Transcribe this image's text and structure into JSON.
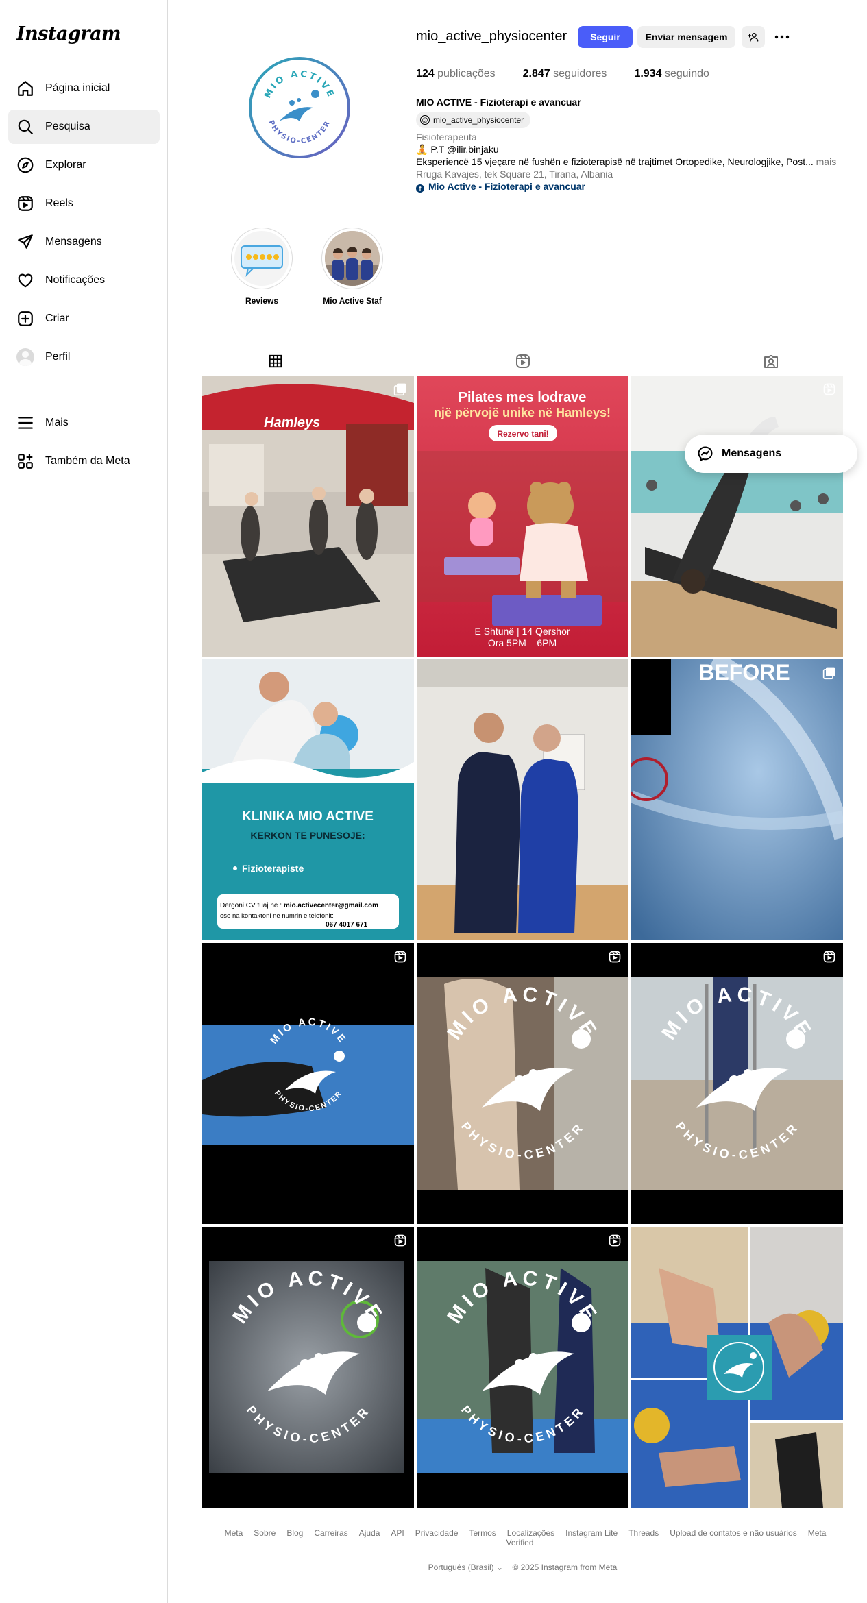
{
  "brand": {
    "logo_text": "Instagram"
  },
  "nav": {
    "items": [
      {
        "label": "Página inicial",
        "icon": "home-icon"
      },
      {
        "label": "Pesquisa",
        "icon": "search-icon"
      },
      {
        "label": "Explorar",
        "icon": "compass-icon"
      },
      {
        "label": "Reels",
        "icon": "reels-icon"
      },
      {
        "label": "Mensagens",
        "icon": "send-icon"
      },
      {
        "label": "Notificações",
        "icon": "heart-icon"
      },
      {
        "label": "Criar",
        "icon": "plus-square-icon"
      },
      {
        "label": "Perfil",
        "icon": "avatar"
      }
    ],
    "bottom": [
      {
        "label": "Mais",
        "icon": "menu-icon"
      },
      {
        "label": "Também da Meta",
        "icon": "meta-apps-icon"
      }
    ]
  },
  "profile": {
    "username": "mio_active_physiocenter",
    "follow_label": "Seguir",
    "message_label": "Enviar mensagem",
    "posts_count": "124",
    "posts_label": "publicações",
    "followers_count": "2.847",
    "followers_label": "seguidores",
    "following_count": "1.934",
    "following_label": "seguindo",
    "full_name": "MIO ACTIVE - Fizioterapi e avancuar",
    "threads_handle": "mio_active_physiocenter",
    "category": "Fisioterapeuta",
    "bio_line1": "🧘 P.T @ilir.binjaku",
    "bio_line2": "Eksperiencë 15 vjeçare në fushën e fizioterapisë në trajtimet Ortopedike, Neurologjike, Post...",
    "bio_more": "mais",
    "address": "Rruga Kavajes, tek Square 21, Tirana, Albania",
    "link_label": "Mio Active - Fizioterapi e avancuar",
    "logo_text_top": "MIO ACTIVE",
    "logo_text_bottom": "PHYSIO-CENTER"
  },
  "highlights": [
    {
      "label": "Reviews"
    },
    {
      "label": "Mio Active Staf"
    }
  ],
  "posts": {
    "p2_title": "Pilates mes lodrave",
    "p2_subtitle": "një përvojë unike në Hamleys!",
    "p2_cta": "Rezervo tani!",
    "p2_date": "E Shtunë | 14 Qershor",
    "p2_time": "Ora 5PM – 6PM",
    "p1_store": "Hamleys",
    "p4_title": "KLINIKA MIO ACTIVE",
    "p4_subtitle": "KERKON TE PUNESOJE:",
    "p4_bullet": "Fizioterapiste",
    "p4_contact_a": "Dergoni CV tuaj ne :",
    "p4_email": "mio.activecenter@gmail.com",
    "p4_contact_b": "ose na kontaktoni ne numrin e telefonit:",
    "p4_phone": "067 4017 671",
    "p6_label": "BEFORE",
    "brand_top": "MIO ACTIVE",
    "brand_bottom": "PHYSIO-CENTER"
  },
  "floating": {
    "messages_label": "Mensagens"
  },
  "footer": {
    "links": [
      "Meta",
      "Sobre",
      "Blog",
      "Carreiras",
      "Ajuda",
      "API",
      "Privacidade",
      "Termos",
      "Localizações",
      "Instagram Lite",
      "Threads",
      "Upload de contatos e não usuários",
      "Meta Verified"
    ],
    "language": "Português (Brasil)",
    "copyright": "© 2025 Instagram from Meta"
  },
  "colors": {
    "accent": "#4a5df9",
    "teal": "#1f97a6",
    "pink_red": "#d6263f",
    "link": "#00376b"
  }
}
